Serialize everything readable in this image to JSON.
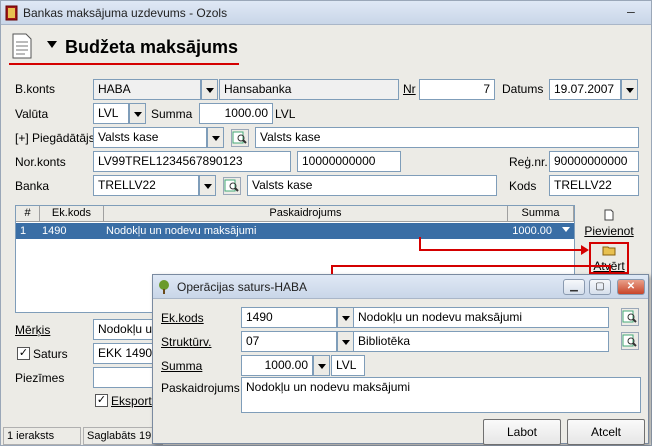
{
  "window": {
    "title": "Bankas maksājuma uzdevums - Ozols",
    "minimize": "–"
  },
  "header": {
    "title": "Budžeta maksājums"
  },
  "form": {
    "bkonts_label": "B.konts",
    "bkonts_value": "HABA",
    "bank_name": "Hansabanka",
    "nr_label": "Nr",
    "nr_value": "7",
    "datums_label": "Datums",
    "datums_value": "19.07.2007",
    "valuta_label": "Valūta",
    "valuta_value": "LVL",
    "summa_label": "Summa",
    "summa_value": "1000.00",
    "summa_currency": "LVL",
    "piegadatajs_label": "[+] Piegādātājs",
    "piegadatajs_value": "Valsts kase",
    "piegadatajs_name": "Valsts kase",
    "norkonts_label": "Nor.konts",
    "norkonts_value": "LV99TREL1234567890123",
    "norkonts_extra": "10000000000",
    "regnr_label": "Reģ.nr.",
    "regnr_value": "90000000000",
    "banka_label": "Banka",
    "banka_value": "TRELLV22",
    "banka_name": "Valsts kase",
    "kods_label": "Kods",
    "kods_value": "TRELLV22"
  },
  "grid": {
    "columns": [
      "#",
      "Ek.kods",
      "Paskaidrojums",
      "Summa"
    ],
    "rows": [
      {
        "n": "1",
        "ekkods": "1490",
        "paskaidrojums": "Nodokļu un nodevu maksājumi",
        "summa": "1000.00"
      }
    ]
  },
  "side_buttons": {
    "pievienot": "Pievienot",
    "atvert": "Atvērt"
  },
  "lower": {
    "merkis_label": "Mērķis",
    "merkis_value": "Nodokļu un nodevu maksājumi",
    "saturs_label": "Saturs",
    "saturs_value": "EKK 1490 Nodokļu",
    "piezimes_label": "Piezīmes",
    "eksportet_label": "Eksportēt"
  },
  "status": {
    "count": "1 ieraksts",
    "saved": "Saglabāts 19.07"
  },
  "dialog": {
    "title": "Operācijas saturs-HABA",
    "ekkods_label": "Ek.kods",
    "ekkods_value": "1490",
    "ekkods_name": "Nodokļu un nodevu maksājumi",
    "struktv_label": "Struktūrv.",
    "struktv_value": "07",
    "struktv_name": "Bibliotēka",
    "summa_label": "Summa",
    "summa_value": "1000.00",
    "summa_currency": "LVL",
    "paskaidrojums_label": "Paskaidrojums",
    "paskaidrojums_value": "Nodokļu un nodevu maksājumi",
    "labot": "Labot",
    "atcelt": "Atcelt"
  },
  "colors": {
    "selection": "#3a6ea5",
    "accent_red": "#d40000",
    "field_border": "#7f9db9"
  }
}
